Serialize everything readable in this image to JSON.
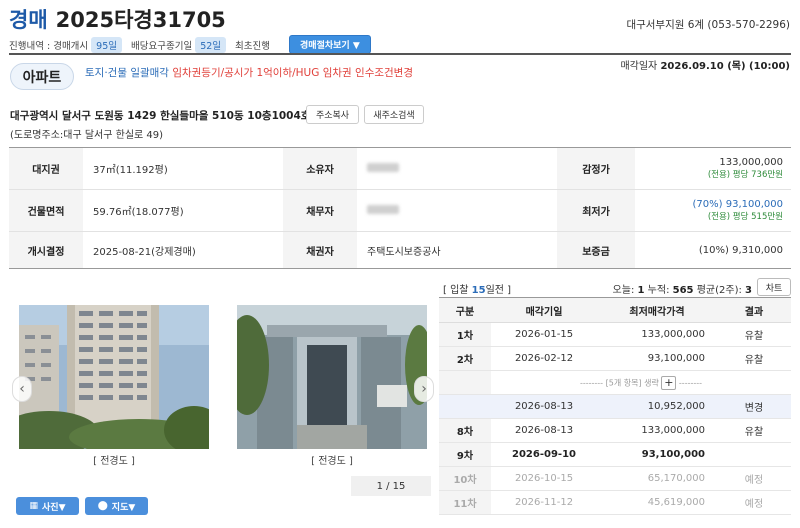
{
  "header": {
    "type": "경매",
    "case_no": "2025타경31705",
    "court": "대구서부지원 6계 (053-570-2296)"
  },
  "subline": {
    "start_label": "진행내역 : 경매개시",
    "start_days": "95일",
    "dividend_label": "배당요구종기일",
    "dividend_days": "52일",
    "first_label": "최초진행",
    "procedure_button": "경매절차보기 ▼"
  },
  "property": {
    "type": "아파트",
    "note_blue": "토지·건물 일괄매각",
    "note_red": "임차권등기/공시가 1억이하/HUG 임차권 인수조건변경",
    "sale_date_label": "매각일자",
    "sale_date": "2026.09.10 (목) (10:00)",
    "address": "대구광역시 달서구 도원동 1429 한실들마을 510동 10층1004호",
    "copy_button": "주소복사",
    "search_button": "새주소검색",
    "road_address": "(도로명주소:대구 달서구 한실로 49)"
  },
  "info": {
    "land_label": "대지권",
    "land_value": "37㎡(11.192평)",
    "owner_label": "소유자",
    "appraisal_label": "감정가",
    "appraisal_value": "133,000,000",
    "appraisal_sub": "(전용) 평당 736만원",
    "area_label": "건물면적",
    "area_value": "59.76㎡(18.077평)",
    "debtor_label": "채무자",
    "min_label": "최저가",
    "min_value": "(70%) 93,100,000",
    "min_sub": "(전용) 평당 515만원",
    "start_label": "개시결정",
    "start_value": "2025-08-21(강제경매)",
    "creditor_label": "채권자",
    "creditor_value": "주택도시보증공사",
    "deposit_label": "보증금",
    "deposit_value": "(10%) 9,310,000"
  },
  "gallery": {
    "caption1": "[ 전경도 ]",
    "caption2": "[ 전경도 ]",
    "pager": "1 / 15",
    "photo_button": "사진▼",
    "map_button": "지도▼"
  },
  "bids": {
    "head_prefix": "[ 입찰",
    "head_days": "15",
    "head_suffix": "일전 ]",
    "stats_today_label": "오늘:",
    "stats_today": "1",
    "stats_total_label": "누적:",
    "stats_total": "565",
    "stats_avg_label": "평균(2주):",
    "stats_avg": "3",
    "chart_button": "차트",
    "columns": [
      "구분",
      "매각기일",
      "최저매각가격",
      "결과"
    ],
    "omitted_text": "-------- [5개 항목] 생략",
    "omitted_tail": "--------",
    "rows": [
      {
        "round": "1차",
        "date": "2026-01-15",
        "price": "133,000,000",
        "result": "유찰"
      },
      {
        "round": "2차",
        "date": "2026-02-12",
        "price": "93,100,000",
        "result": "유찰"
      },
      {
        "round": "",
        "date": "2026-08-13",
        "price": "10,952,000",
        "result": "변경"
      },
      {
        "round": "8차",
        "date": "2026-08-13",
        "price": "133,000,000",
        "result": "유찰"
      },
      {
        "round": "9차",
        "date": "2026-09-10",
        "price": "93,100,000",
        "result": ""
      },
      {
        "round": "10차",
        "date": "2026-10-15",
        "price": "65,170,000",
        "result": "예정"
      },
      {
        "round": "11차",
        "date": "2026-11-12",
        "price": "45,619,000",
        "result": "예정"
      }
    ]
  }
}
